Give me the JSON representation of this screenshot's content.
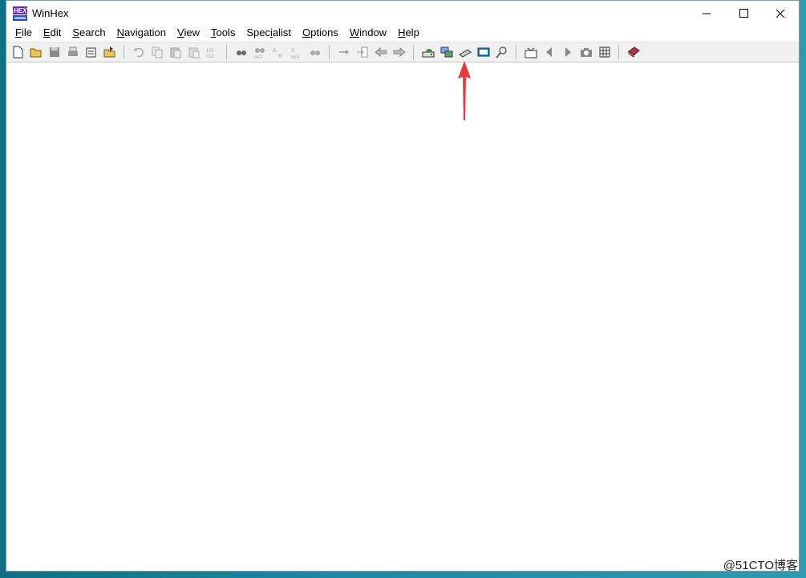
{
  "window": {
    "title": "WinHex",
    "controls": {
      "minimize": "—",
      "maximize": "☐",
      "close": "✕"
    }
  },
  "menu": [
    {
      "label": "File",
      "key": "F",
      "rest": "ile"
    },
    {
      "label": "Edit",
      "key": "E",
      "rest": "dit"
    },
    {
      "label": "Search",
      "key": "S",
      "rest": "earch"
    },
    {
      "label": "Navigation",
      "key": "N",
      "rest": "avigation"
    },
    {
      "label": "View",
      "key": "V",
      "rest": "iew"
    },
    {
      "label": "Tools",
      "key": "T",
      "rest": "ools"
    },
    {
      "label": "Specialist",
      "pre": "Spec",
      "key": "i",
      "rest": "alist"
    },
    {
      "label": "Options",
      "key": "O",
      "rest": "ptions"
    },
    {
      "label": "Window",
      "key": "W",
      "rest": "indow"
    },
    {
      "label": "Help",
      "key": "H",
      "rest": "elp"
    }
  ],
  "toolbar": {
    "groups": [
      [
        "new-file-icon",
        "open-folder-icon",
        "save-icon",
        "print-icon",
        "properties-icon",
        "open-multiple-icon"
      ],
      [
        "undo-icon",
        "copy-icon",
        "paste-icon",
        "paste-special-icon",
        "binary-edit-icon"
      ],
      [
        "find-text-icon",
        "find-hex-icon",
        "replace-text-icon",
        "replace-hex-icon",
        "find-again-icon"
      ],
      [
        "goto-offset-icon",
        "goto-sector-icon",
        "back-icon",
        "forward-icon"
      ],
      [
        "open-disk-icon",
        "clone-disk-icon",
        "ram-editor-icon",
        "calculator-icon",
        "analyze-icon"
      ],
      [
        "snapshot-icon",
        "previous-icon",
        "next-icon",
        "camera-icon",
        "table-icon"
      ],
      [
        "help-book-icon"
      ]
    ],
    "highlighted": "open-disk-icon"
  },
  "colors": {
    "accent_arrow": "#e8393a",
    "titlebar": "#ffffff",
    "toolbar": "#f0f0f0"
  },
  "watermark": "@51CTO博客"
}
